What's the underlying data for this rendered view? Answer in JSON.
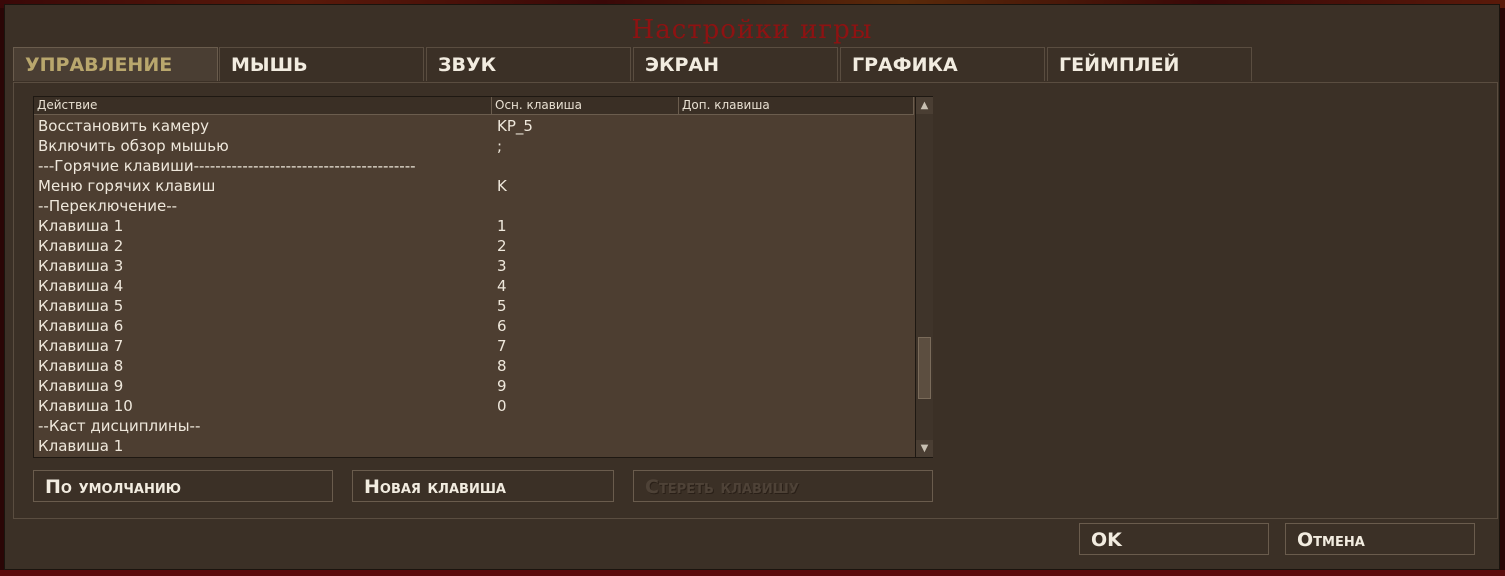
{
  "dialog": {
    "title": "Настройки игры"
  },
  "tabs": [
    {
      "label": "Управление"
    },
    {
      "label": "Мышь"
    },
    {
      "label": "Звук"
    },
    {
      "label": "Экран"
    },
    {
      "label": "Графика"
    },
    {
      "label": "Геймплей"
    }
  ],
  "keys_table": {
    "columns": [
      "Действие",
      "Осн. клавиша",
      "Доп. клавиша"
    ],
    "rows": [
      {
        "action": "Восстановить камеру",
        "primary": "KP_5",
        "secondary": ""
      },
      {
        "action": "Включить обзор мышью",
        "primary": ";",
        "secondary": ""
      },
      {
        "action": "---Горячие клавиши-----------------------------------------",
        "primary": "",
        "secondary": ""
      },
      {
        "action": "Меню горячих клавиш",
        "primary": "K",
        "secondary": ""
      },
      {
        "action": "--Переключение--",
        "primary": "",
        "secondary": ""
      },
      {
        "action": "Клавиша 1",
        "primary": "1",
        "secondary": ""
      },
      {
        "action": "Клавиша 2",
        "primary": "2",
        "secondary": ""
      },
      {
        "action": "Клавиша 3",
        "primary": "3",
        "secondary": ""
      },
      {
        "action": "Клавиша 4",
        "primary": "4",
        "secondary": ""
      },
      {
        "action": "Клавиша 5",
        "primary": "5",
        "secondary": ""
      },
      {
        "action": "Клавиша 6",
        "primary": "6",
        "secondary": ""
      },
      {
        "action": "Клавиша 7",
        "primary": "7",
        "secondary": ""
      },
      {
        "action": "Клавиша 8",
        "primary": "8",
        "secondary": ""
      },
      {
        "action": "Клавиша 9",
        "primary": "9",
        "secondary": ""
      },
      {
        "action": "Клавиша 10",
        "primary": "0",
        "secondary": ""
      },
      {
        "action": "--Каст дисциплины--",
        "primary": "",
        "secondary": ""
      },
      {
        "action": "Клавиша 1",
        "primary": "",
        "secondary": ""
      }
    ]
  },
  "buttons": {
    "default": "По умолчанию",
    "new_key": "Новая клавиша",
    "erase_key": "Стереть клавишу",
    "ok": "OK",
    "cancel": "Отмена"
  },
  "icons": {
    "scroll_up": "triangle-up-icon",
    "scroll_down": "triangle-down-icon"
  },
  "colors": {
    "title": "#8e1212",
    "active_tab": "#b9a76d",
    "panel": "#3b3026",
    "table_bg": "#4d3e31"
  }
}
